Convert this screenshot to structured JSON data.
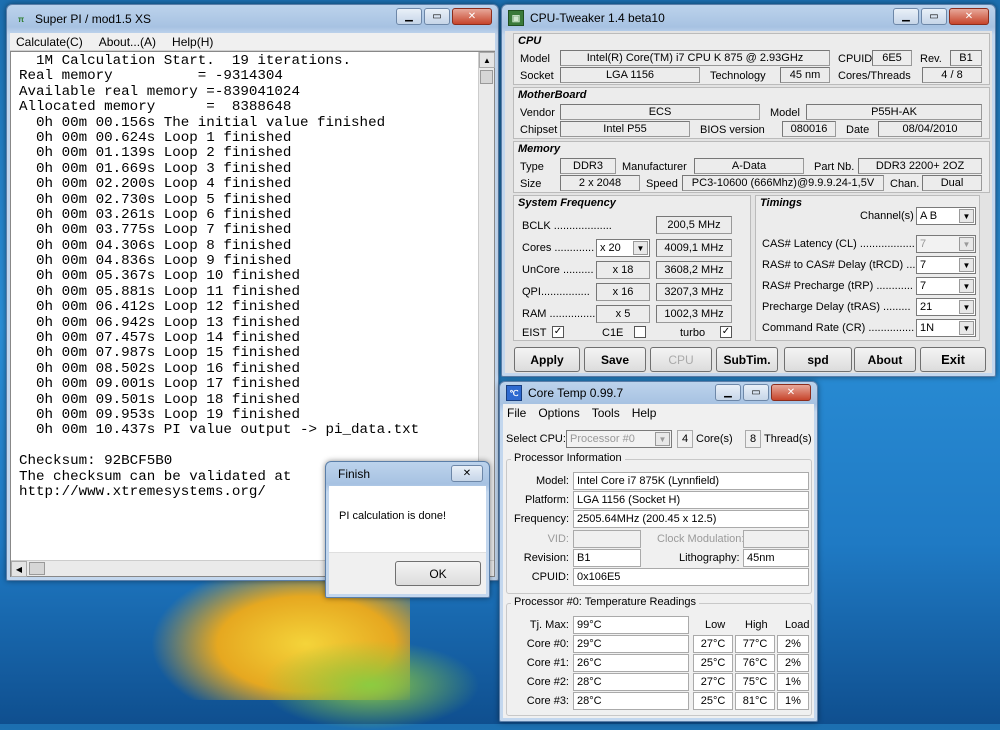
{
  "superpi": {
    "title": "Super PI / mod1.5 XS",
    "menu": [
      "Calculate(C)",
      "About...(A)",
      "Help(H)"
    ],
    "lines": [
      "  1M Calculation Start.  19 iterations.",
      "Real memory          = -9314304",
      "Available real memory =-839041024",
      "Allocated memory      =  8388648",
      "  0h 00m 00.156s The initial value finished",
      "  0h 00m 00.624s Loop 1 finished",
      "  0h 00m 01.139s Loop 2 finished",
      "  0h 00m 01.669s Loop 3 finished",
      "  0h 00m 02.200s Loop 4 finished",
      "  0h 00m 02.730s Loop 5 finished",
      "  0h 00m 03.261s Loop 6 finished",
      "  0h 00m 03.775s Loop 7 finished",
      "  0h 00m 04.306s Loop 8 finished",
      "  0h 00m 04.836s Loop 9 finished",
      "  0h 00m 05.367s Loop 10 finished",
      "  0h 00m 05.881s Loop 11 finished",
      "  0h 00m 06.412s Loop 12 finished",
      "  0h 00m 06.942s Loop 13 finished",
      "  0h 00m 07.457s Loop 14 finished",
      "  0h 00m 07.987s Loop 15 finished",
      "  0h 00m 08.502s Loop 16 finished",
      "  0h 00m 09.001s Loop 17 finished",
      "  0h 00m 09.501s Loop 18 finished",
      "  0h 00m 09.953s Loop 19 finished",
      "  0h 00m 10.437s PI value output -> pi_data.txt",
      "",
      "Checksum: 92BCF5B0",
      "The checksum can be validated at",
      "http://www.xtremesystems.org/"
    ]
  },
  "finish": {
    "title": "Finish",
    "message": "PI calculation is done!",
    "ok": "OK"
  },
  "tweaker": {
    "title": "CPU-Tweaker 1.4 beta10",
    "cpu": {
      "group": "CPU",
      "model_label": "Model",
      "model": "Intel(R) Core(TM) i7 CPU      K 875  @ 2.93GHz",
      "cpuid_label": "CPUID",
      "cpuid": "6E5",
      "rev_label": "Rev.",
      "rev": "B1",
      "socket_label": "Socket",
      "socket": "LGA 1156",
      "tech_label": "Technology",
      "tech": "45 nm",
      "ct_label": "Cores/Threads",
      "ct": "4 / 8"
    },
    "mb": {
      "group": "MotherBoard",
      "vendor_label": "Vendor",
      "vendor": "ECS",
      "model_label": "Model",
      "model": "P55H-AK",
      "chipset_label": "Chipset",
      "chipset": "Intel P55",
      "bios_label": "BIOS version",
      "bios": "080016",
      "date_label": "Date",
      "date": "08/04/2010"
    },
    "mem": {
      "group": "Memory",
      "type_label": "Type",
      "type": "DDR3",
      "manu_label": "Manufacturer",
      "manu": "A-Data",
      "part_label": "Part Nb.",
      "part": "DDR3 2200+ 2OZ",
      "size_label": "Size",
      "size": "2 x 2048",
      "speed_label": "Speed",
      "speed": "PC3-10600 (666Mhz)@9.9.9.24-1,5V",
      "chan_label": "Chan.",
      "chan": "Dual"
    },
    "freq": {
      "group": "System Frequency",
      "bclk_label": "BCLK ...................",
      "bclk": "200,5 MHz",
      "cores_label": "Cores .............",
      "cores_mult": "x 20",
      "cores": "4009,1 MHz",
      "uncore_label": "UnCore ..........",
      "uncore_mult": "x 18",
      "uncore": "3608,2 MHz",
      "qpi_label": "QPI................",
      "qpi_mult": "x 16",
      "qpi": "3207,3 MHz",
      "ram_label": "RAM ...............",
      "ram_mult": "x 5",
      "ram": "1002,3 MHz",
      "eist": "EIST",
      "c1e": "C1E",
      "turbo": "turbo"
    },
    "timings": {
      "group": "Timings",
      "channel_label": "Channel(s)",
      "channel": "A  B",
      "cl_label": "CAS# Latency (CL) ..................",
      "cl": "7",
      "trcd_label": "RAS# to CAS# Delay (tRCD) ...",
      "trcd": "7",
      "trp_label": "RAS# Precharge (tRP) ............",
      "trp": "7",
      "tras_label": "Precharge Delay (tRAS) .........",
      "tras": "21",
      "cr_label": "Command Rate (CR) ...............",
      "cr": "1N"
    },
    "buttons": {
      "apply": "Apply",
      "save": "Save",
      "cpu": "CPU",
      "subtim": "SubTim.",
      "spd": "spd",
      "about": "About",
      "exit": "Exit"
    }
  },
  "coretemp": {
    "title": "Core Temp 0.99.7",
    "menu": [
      "File",
      "Options",
      "Tools",
      "Help"
    ],
    "select_cpu_label": "Select CPU:",
    "select_cpu": "Processor #0",
    "cores_num": "4",
    "cores_label": "Core(s)",
    "threads_num": "8",
    "threads_label": "Thread(s)",
    "info_title": "Processor Information",
    "model_label": "Model:",
    "model": "Intel Core i7 875K (Lynnfield)",
    "platform_label": "Platform:",
    "platform": "LGA 1156 (Socket H)",
    "freq_label": "Frequency:",
    "freq": "2505.64MHz (200.45 x 12.5)",
    "vid_label": "VID:",
    "clockmod_label": "Clock Modulation:",
    "rev_label": "Revision:",
    "rev": "B1",
    "litho_label": "Lithography:",
    "litho": "45nm",
    "cpuid_label": "CPUID:",
    "cpuid": "0x106E5",
    "temp_title": "Processor #0: Temperature Readings",
    "tjmax_label": "Tj. Max:",
    "tjmax": "99°C",
    "col_low": "Low",
    "col_high": "High",
    "col_load": "Load",
    "cores": [
      {
        "name": "Core #0:",
        "temp": "29°C",
        "low": "27°C",
        "high": "77°C",
        "load": "2%"
      },
      {
        "name": "Core #1:",
        "temp": "26°C",
        "low": "25°C",
        "high": "76°C",
        "load": "2%"
      },
      {
        "name": "Core #2:",
        "temp": "28°C",
        "low": "27°C",
        "high": "75°C",
        "load": "1%"
      },
      {
        "name": "Core #3:",
        "temp": "28°C",
        "low": "25°C",
        "high": "81°C",
        "load": "1%"
      }
    ]
  }
}
